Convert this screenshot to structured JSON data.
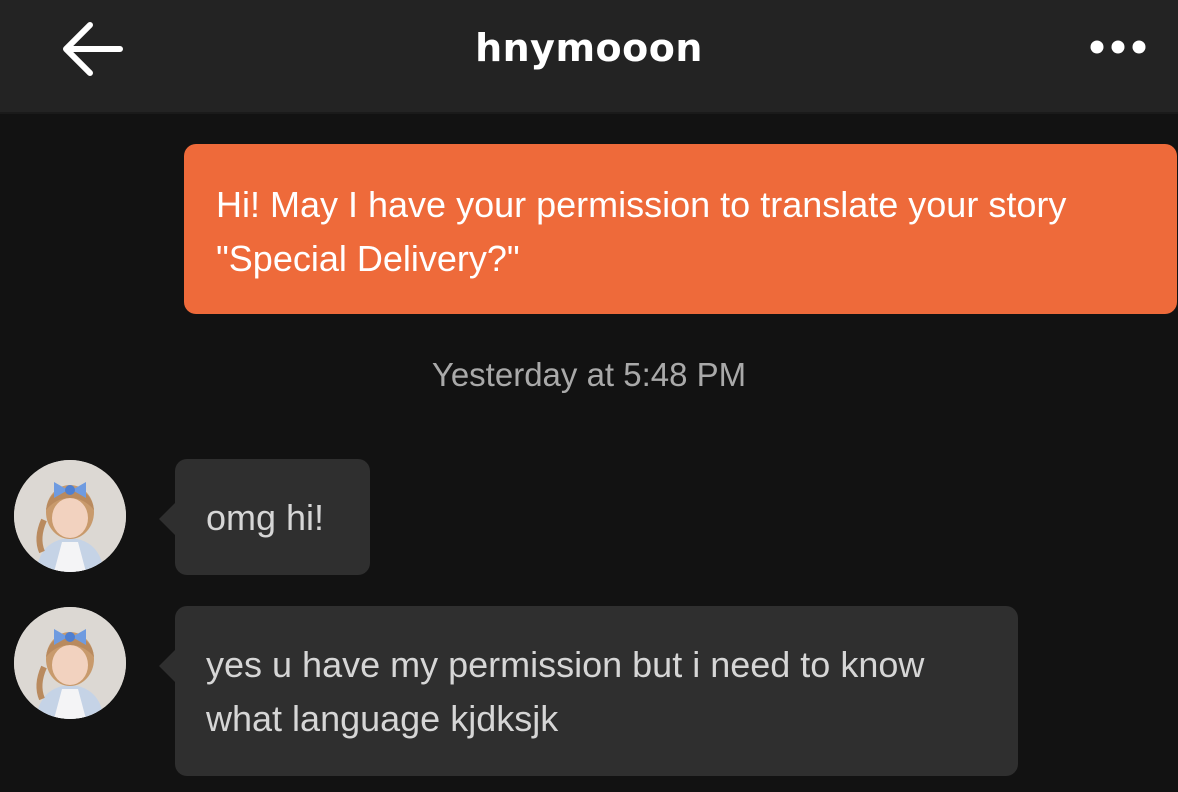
{
  "header": {
    "title": "hnymooon",
    "back_icon": "arrow-left-icon",
    "more_icon": "more-horizontal-icon"
  },
  "messages": [
    {
      "direction": "outgoing",
      "lines": [
        "Hi! May I have your permission to translate your story",
        "\"Special Delivery?\""
      ]
    },
    {
      "direction": "incoming",
      "lines": [
        "omg hi!"
      ]
    },
    {
      "direction": "incoming",
      "lines": [
        "yes u have my permission but i need to know",
        "what language kjdksjk"
      ]
    }
  ],
  "timestamp": "Yesterday at 5:48 PM",
  "colors": {
    "outgoing_bubble": "#ee6a3a",
    "incoming_bubble": "#2f2f2f",
    "background": "#121212",
    "header_background": "#232323"
  }
}
